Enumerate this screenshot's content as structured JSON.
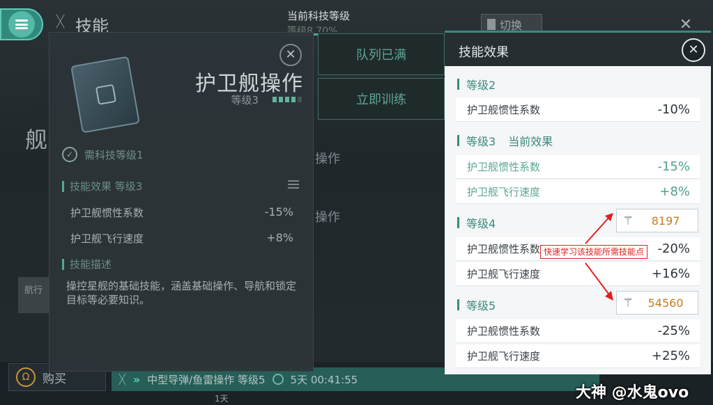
{
  "top_bar": {
    "page_title": "技能",
    "tech_level_label": "当前科技等级",
    "tech_level_value": "等级8 70%",
    "switch_label": "切换"
  },
  "background": {
    "ship_label": "舰",
    "nav_label": "航行",
    "queue_full": "队列已满",
    "train_now": "立即训练",
    "op_label_1": "操作",
    "op_label_2": "操作",
    "buy_label": "购买",
    "queue_item": "中型导弹/鱼雷操作 等级5",
    "queue_time": "5天 00:41:55",
    "day_label": "1天"
  },
  "skill_panel": {
    "name": "护卫舰操作",
    "level": "等级3",
    "level_progress": {
      "filled": 4,
      "total": 5
    },
    "requirement": "需科技等级1",
    "effects_heading": "技能效果 等级3",
    "effects": [
      {
        "name": "护卫舰惯性系数",
        "value": "-15%"
      },
      {
        "name": "护卫舰飞行速度",
        "value": "+8%"
      }
    ],
    "desc_heading": "技能描述",
    "description": "操控星舰的基础技能，涵盖基础操作、导航和锁定目标等必要知识。"
  },
  "effects_panel": {
    "title": "技能效果",
    "levels": [
      {
        "heading": "等级2",
        "current_tag": "",
        "rows": [
          {
            "name": "护卫舰惯性系数",
            "value": "-10%"
          }
        ]
      },
      {
        "heading": "等级3",
        "current_tag": "当前效果",
        "rows": [
          {
            "name": "护卫舰惯性系数",
            "value": "-15%"
          },
          {
            "name": "护卫舰飞行速度",
            "value": "+8%"
          }
        ]
      },
      {
        "heading": "等级4",
        "cost": "8197",
        "rows": [
          {
            "name": "护卫舰惯性系数",
            "value": "-20%"
          },
          {
            "name": "护卫舰飞行速度",
            "value": "+16%"
          }
        ]
      },
      {
        "heading": "等级5",
        "cost": "54560",
        "rows": [
          {
            "name": "护卫舰惯性系数",
            "value": "-25%"
          },
          {
            "name": "护卫舰飞行速度",
            "value": "+25%"
          }
        ]
      }
    ]
  },
  "annotation": {
    "text": "快速学习该技能所需技能点",
    "color": "#e02020"
  },
  "watermark": "大神 @水鬼ovo",
  "colors": {
    "accent": "#3c8a7e",
    "cost": "#c47d1c"
  }
}
